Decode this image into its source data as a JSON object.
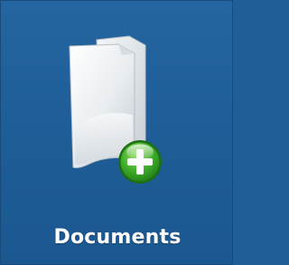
{
  "tile": {
    "label": "Documents",
    "icon": "documents-add-icon",
    "background_color": "#1f5e97",
    "badge_color": "#3fae2a"
  }
}
